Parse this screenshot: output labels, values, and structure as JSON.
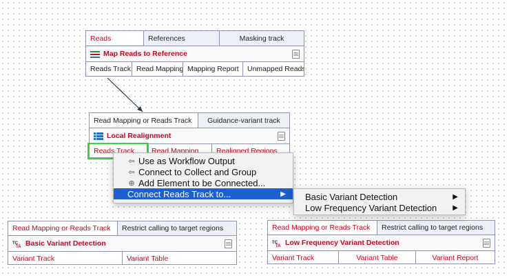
{
  "map_reads": {
    "inputs": [
      "Reads",
      "References",
      "Masking track"
    ],
    "title": "Map Reads to Reference",
    "outputs": [
      "Reads Track",
      "Read Mapping",
      "Mapping Report",
      "Unmapped Reads"
    ]
  },
  "local_realign": {
    "inputs": [
      "Read Mapping or Reads Track",
      "Guidance-variant track"
    ],
    "title": "Local Realignment",
    "outputs": [
      "Reads Track",
      "Read Mapping",
      "Realigned Regions"
    ]
  },
  "basic_variant": {
    "inputs": [
      "Read Mapping or Reads Track",
      "Restrict calling to target regions"
    ],
    "title": "Basic Variant Detection",
    "outputs": [
      "Variant Track",
      "Variant Table"
    ]
  },
  "low_freq_variant": {
    "inputs": [
      "Read Mapping or Reads Track",
      "Restrict calling to target regions"
    ],
    "title": "Low Frequency Variant Detection",
    "outputs": [
      "Variant Track",
      "Variant Table",
      "Variant Report"
    ]
  },
  "context_menu": {
    "items": [
      "Use as Workflow Output",
      "Connect to Collect and Group",
      "Add Element to be Connected...",
      "Connect Reads Track to..."
    ]
  },
  "submenu": {
    "items": [
      "Basic Variant Detection",
      "Low Frequency Variant Detection"
    ]
  },
  "icons": [
    "doc-icon",
    "map-reads-icon",
    "realign-icon",
    "variant-icon",
    "arrow-left-icon",
    "plus-icon",
    "chevron-right-icon"
  ],
  "colors": {
    "accent_red": "#d0021b",
    "menu_highlight": "#1b5fd1",
    "selection_green": "#3ad13a"
  }
}
